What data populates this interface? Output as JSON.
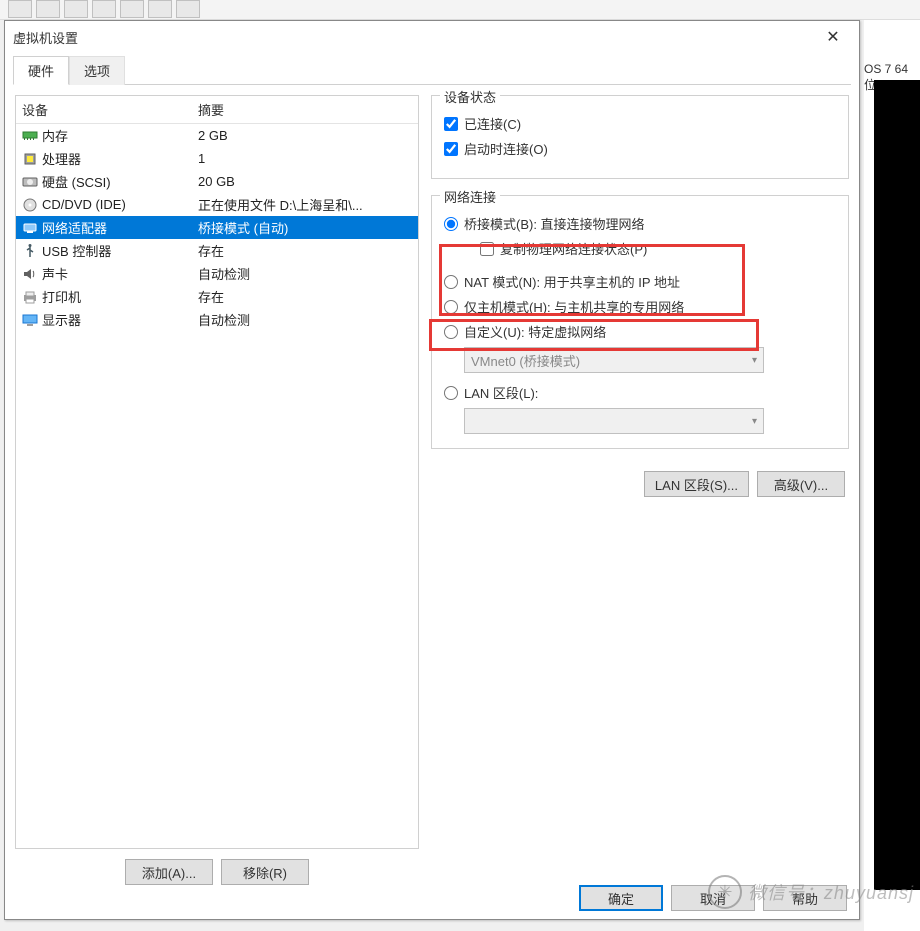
{
  "bg": {
    "os_label": "OS 7 64 位"
  },
  "dialog": {
    "title": "虚拟机设置",
    "tabs": {
      "hardware": "硬件",
      "options": "选项"
    },
    "columns": {
      "device": "设备",
      "summary": "摘要"
    },
    "devices": [
      {
        "key": "memory",
        "name": "内存",
        "summary": "2 GB"
      },
      {
        "key": "cpu",
        "name": "处理器",
        "summary": "1"
      },
      {
        "key": "disk",
        "name": "硬盘 (SCSI)",
        "summary": "20 GB"
      },
      {
        "key": "cd",
        "name": "CD/DVD (IDE)",
        "summary": "正在使用文件 D:\\上海呈和\\..."
      },
      {
        "key": "net",
        "name": "网络适配器",
        "summary": "桥接模式 (自动)"
      },
      {
        "key": "usb",
        "name": "USB 控制器",
        "summary": "存在"
      },
      {
        "key": "sound",
        "name": "声卡",
        "summary": "自动检测"
      },
      {
        "key": "printer",
        "name": "打印机",
        "summary": "存在"
      },
      {
        "key": "display",
        "name": "显示器",
        "summary": "自动检测"
      }
    ],
    "selected_device_index": 4,
    "buttons": {
      "add": "添加(A)...",
      "remove": "移除(R)"
    },
    "device_state": {
      "title": "设备状态",
      "connected": "已连接(C)",
      "connect_on_power": "启动时连接(O)"
    },
    "network": {
      "title": "网络连接",
      "bridged": "桥接模式(B): 直接连接物理网络",
      "replicate": "复制物理网络连接状态(P)",
      "nat": "NAT 模式(N): 用于共享主机的 IP 地址",
      "hostonly": "仅主机模式(H): 与主机共享的专用网络",
      "custom": "自定义(U): 特定虚拟网络",
      "custom_value": "VMnet0 (桥接模式)",
      "lan": "LAN 区段(L):",
      "lan_value": ""
    },
    "right_buttons": {
      "lan_segments": "LAN 区段(S)...",
      "advanced": "高级(V)..."
    },
    "footer": {
      "ok": "确定",
      "cancel": "取消",
      "help": "帮助"
    }
  },
  "watermark": "微信号：zhuyuansj"
}
